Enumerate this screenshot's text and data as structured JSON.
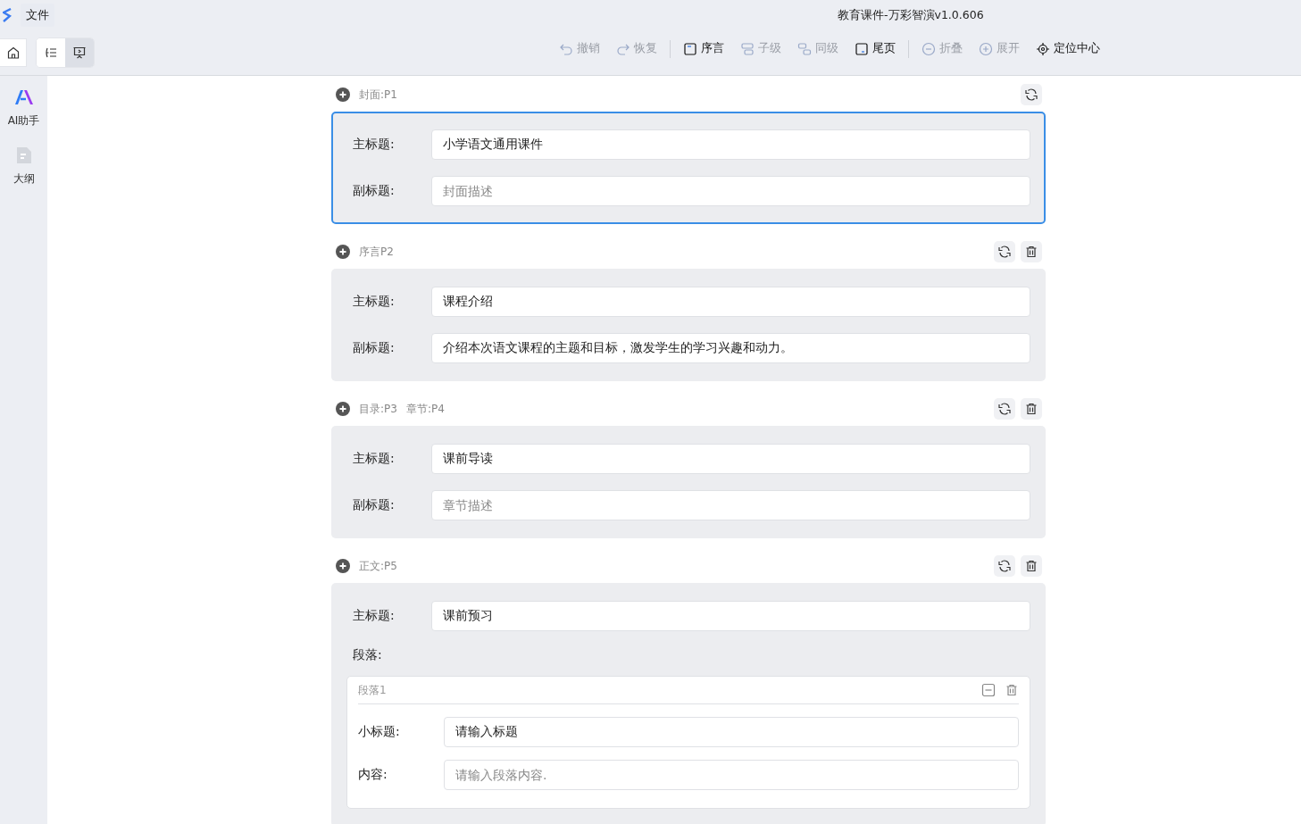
{
  "menu": {
    "file": "文件"
  },
  "window": {
    "title": "教育课件-万彩智演v1.0.606"
  },
  "view_toggles": [
    {
      "kind": "outline",
      "selected": false
    },
    {
      "kind": "present",
      "selected": true
    }
  ],
  "toolbar": [
    [
      {
        "kind": "undo",
        "label": "撤销",
        "disabled": true
      },
      {
        "kind": "redo",
        "label": "恢复",
        "disabled": true
      }
    ],
    [
      {
        "kind": "preface",
        "label": "序言",
        "disabled": false
      },
      {
        "kind": "child",
        "label": "子级",
        "disabled": true
      },
      {
        "kind": "sibling",
        "label": "同级",
        "disabled": true
      },
      {
        "kind": "end",
        "label": "尾页",
        "disabled": false
      }
    ],
    [
      {
        "kind": "collapse",
        "label": "折叠",
        "disabled": true
      },
      {
        "kind": "expand",
        "label": "展开",
        "disabled": true
      },
      {
        "kind": "locate",
        "label": "定位中心",
        "disabled": false
      }
    ]
  ],
  "sidebar": {
    "items": [
      {
        "kind": "ai",
        "label": "AI助手"
      },
      {
        "kind": "outline",
        "label": "大纲"
      }
    ]
  },
  "sections": [
    {
      "labels": [
        "封面:P1"
      ],
      "deletable": false,
      "selected": true,
      "fields": [
        {
          "label": "主标题:",
          "value": "小学语文通用课件"
        },
        {
          "label": "副标题:",
          "placeholder": "封面描述"
        }
      ]
    },
    {
      "labels": [
        "序言P2"
      ],
      "deletable": true,
      "selected": false,
      "fields": [
        {
          "label": "主标题:",
          "value": "课程介绍"
        },
        {
          "label": "副标题:",
          "value": "介绍本次语文课程的主题和目标，激发学生的学习兴趣和动力。"
        }
      ]
    },
    {
      "labels": [
        "目录:P3",
        "章节:P4"
      ],
      "deletable": true,
      "selected": false,
      "fields": [
        {
          "label": "主标题:",
          "value": "课前导读"
        },
        {
          "label": "副标题:",
          "placeholder": "章节描述"
        }
      ]
    },
    {
      "labels": [
        "正文:P5"
      ],
      "deletable": true,
      "selected": false,
      "fields": [
        {
          "label": "主标题:",
          "value": "课前预习"
        }
      ],
      "paragraphs_label": "段落:",
      "paragraphs": [
        {
          "title": "段落1",
          "fields": [
            {
              "label": "小标题:",
              "value": "请输入标题"
            },
            {
              "label": "内容:",
              "placeholder": "请输入段落内容."
            }
          ]
        }
      ]
    }
  ]
}
